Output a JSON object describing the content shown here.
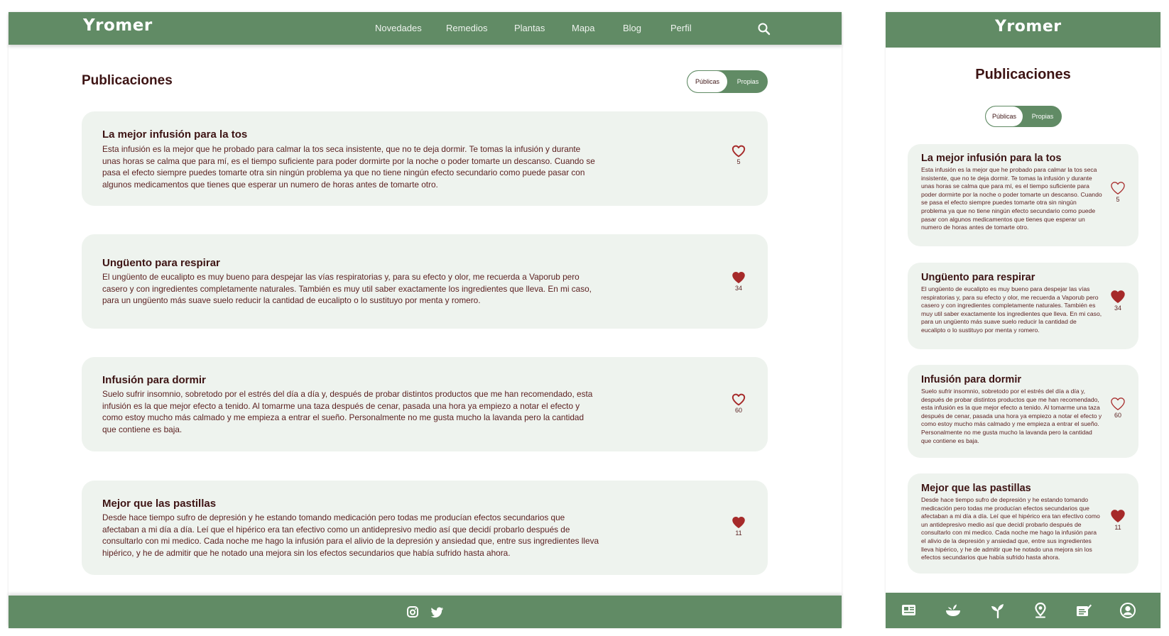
{
  "brand": {
    "logo": "Yromer"
  },
  "nav": {
    "items": [
      "Novedades",
      "Remedios",
      "Plantas",
      "Mapa",
      "Blog",
      "Perfil"
    ],
    "search_icon": "search-icon"
  },
  "page": {
    "title": "Publicaciones",
    "toggle": {
      "public_label": "Públicas",
      "own_label": "Propias",
      "selected": "Públicas"
    }
  },
  "posts": [
    {
      "title": "La mejor infusión para la tos",
      "body": "Esta infusión es la mejor que he probado para calmar la tos seca insistente, que no te deja dormir. Te tomas la infusión y durante unas horas se calma que para mí, es el tiempo suficiente para poder dormirte por la noche o poder tomarte un descanso. Cuando se pasa el efecto siempre puedes tomarte otra sin ningún problema ya que no tiene ningún efecto secundario como puede pasar con algunos medicamentos que tienes que esperar un numero de horas antes de tomarte otro.",
      "likes": "5",
      "liked": false
    },
    {
      "title": "Ungüento para respirar",
      "body": "El ungüento de eucalipto es muy bueno para despejar las vías respiratorias y, para su efecto y olor, me recuerda a Vaporub pero casero y con ingredientes completamente naturales. También es muy util saber exactamente los ingredientes que lleva. En mi caso, para un ungüento más suave suelo reducir la cantidad de eucalipto o lo sustituyo por menta y romero.",
      "likes": "34",
      "liked": true
    },
    {
      "title": "Infusión para dormir",
      "body": "Suelo sufrir insomnio, sobretodo por el estrés del día a día y, después de probar distintos productos que me han recomendado, esta infusión es la que mejor efecto a tenido. Al tomarme una taza después de cenar, pasada una hora ya empiezo a notar el efecto y como estoy mucho más calmado y me empieza a entrar el sueño. Personalmente no me gusta mucho la lavanda pero la cantidad que contiene es baja.",
      "likes": "60",
      "liked": false
    },
    {
      "title": "Mejor que las pastillas",
      "body": "Desde hace tiempo sufro de depresión y he estando tomando medicación pero todas me producían efectos secundarios que afectaban a mi día a día. Leí que el hipérico era tan efectivo como un antidepresivo medio así que decidí probarlo después de consultarlo con mi medico. Cada noche me hago la infusión para el alivio de la depresión y ansiedad que, entre sus ingredientes lleva hipérico, y he de admitir que he notado una mejora sin los efectos secundarios que había sufrido hasta ahora.",
      "likes": "11",
      "liked": true
    }
  ],
  "footer": {
    "social_icons": [
      "instagram-icon",
      "twitter-icon"
    ]
  },
  "mobile_tabbar": {
    "icons": [
      "news-icon",
      "remedies-bowl-icon",
      "plant-sprout-icon",
      "map-pin-icon",
      "blog-icon",
      "profile-icon"
    ]
  },
  "colors": {
    "primary_green": "#618b65",
    "card_bg": "#eef3ee",
    "text_dark": "#3d1414",
    "heart": "#a62a2a"
  }
}
